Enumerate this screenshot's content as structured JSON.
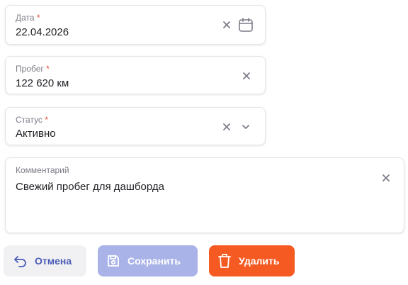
{
  "form": {
    "date": {
      "label": "Дата",
      "required_mark": "*",
      "value": "22.04.2026"
    },
    "mileage": {
      "label": "Пробег",
      "required_mark": "*",
      "value": "122 620 км"
    },
    "status": {
      "label": "Статус",
      "required_mark": "*",
      "value": "Активно"
    },
    "comment": {
      "label": "Комментарий",
      "value": "Свежий пробег для дашборда"
    }
  },
  "buttons": {
    "cancel": "Отмена",
    "save": "Сохранить",
    "delete": "Удалить"
  },
  "icons": {
    "clear": "close-icon",
    "calendar": "calendar-icon",
    "dropdown": "chevron-down-icon",
    "cancel": "undo-arrow-icon",
    "save": "floppy-disk-icon",
    "delete": "trash-icon"
  },
  "colors": {
    "required": "#e5483b",
    "cancel_bg": "#f1f1f4",
    "cancel_text": "#4a5bb5",
    "save_bg": "#a9b3e8",
    "delete_bg": "#f55a22"
  }
}
